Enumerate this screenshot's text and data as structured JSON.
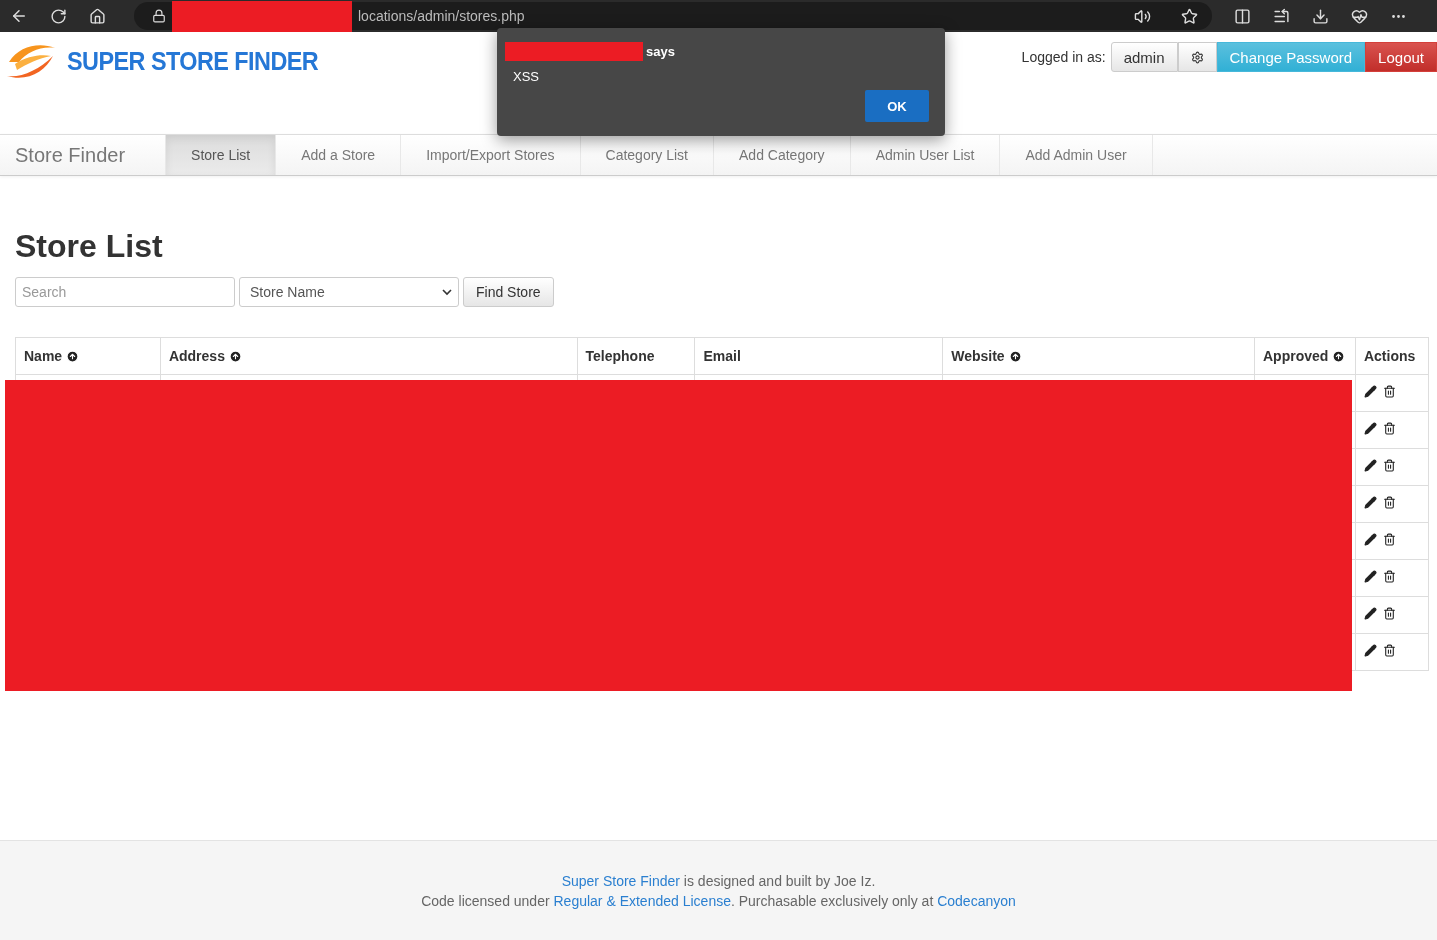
{
  "browser": {
    "url": "locations/admin/stores.php"
  },
  "header": {
    "logo_text": "SUPER STORE FINDER",
    "logged_in_label": "Logged in as:",
    "user": "admin",
    "buttons": [
      {
        "label": "Change Password",
        "kind": "info"
      },
      {
        "label": "Logout",
        "kind": "danger"
      }
    ]
  },
  "nav": {
    "brand": "Store Finder",
    "items": [
      {
        "label": "Store List",
        "selected": true
      },
      {
        "label": "Add a Store",
        "selected": false
      },
      {
        "label": "Import/Export Stores",
        "selected": false
      },
      {
        "label": "Category List",
        "selected": false
      },
      {
        "label": "Add Category",
        "selected": false
      },
      {
        "label": "Admin User List",
        "selected": false
      },
      {
        "label": "Add Admin User",
        "selected": false
      }
    ]
  },
  "page_title": "Store List",
  "search": {
    "placeholder": "Search",
    "select_value": "Store Name",
    "button": "Find Store"
  },
  "table": {
    "columns": [
      {
        "label": "Name",
        "sortable": true
      },
      {
        "label": "Address",
        "sortable": true
      },
      {
        "label": "Telephone",
        "sortable": false
      },
      {
        "label": "Email",
        "sortable": false
      },
      {
        "label": "Website",
        "sortable": true
      },
      {
        "label": "Approved",
        "sortable": true
      },
      {
        "label": "Actions",
        "sortable": false
      }
    ],
    "rows": [
      {
        "actions": [
          {
            "kind": "edit"
          },
          {
            "kind": "delete"
          }
        ]
      },
      {
        "actions": [
          {
            "kind": "edit"
          },
          {
            "kind": "delete"
          }
        ]
      },
      {
        "actions": [
          {
            "kind": "edit"
          },
          {
            "kind": "delete"
          }
        ]
      },
      {
        "actions": [
          {
            "kind": "edit"
          },
          {
            "kind": "delete"
          }
        ]
      },
      {
        "actions": [
          {
            "kind": "edit"
          },
          {
            "kind": "delete"
          }
        ]
      },
      {
        "actions": [
          {
            "kind": "edit"
          },
          {
            "kind": "delete"
          }
        ]
      },
      {
        "actions": [
          {
            "kind": "edit"
          },
          {
            "kind": "delete"
          }
        ]
      },
      {
        "actions": [
          {
            "kind": "edit"
          },
          {
            "kind": "delete"
          }
        ]
      }
    ]
  },
  "footer": {
    "lines": [
      [
        {
          "text": "Super Store Finder",
          "kind": "link"
        },
        {
          "text": " is designed and built by Joe Iz.",
          "kind": "text"
        }
      ],
      [
        {
          "text": "Code licensed under ",
          "kind": "text"
        },
        {
          "text": "Regular & Extended License",
          "kind": "link"
        },
        {
          "text": ". Purchasable exclusively only at ",
          "kind": "text"
        },
        {
          "text": "Codecanyon",
          "kind": "link"
        }
      ]
    ]
  },
  "dialog": {
    "says": "says",
    "message": "XSS",
    "button": "OK"
  }
}
